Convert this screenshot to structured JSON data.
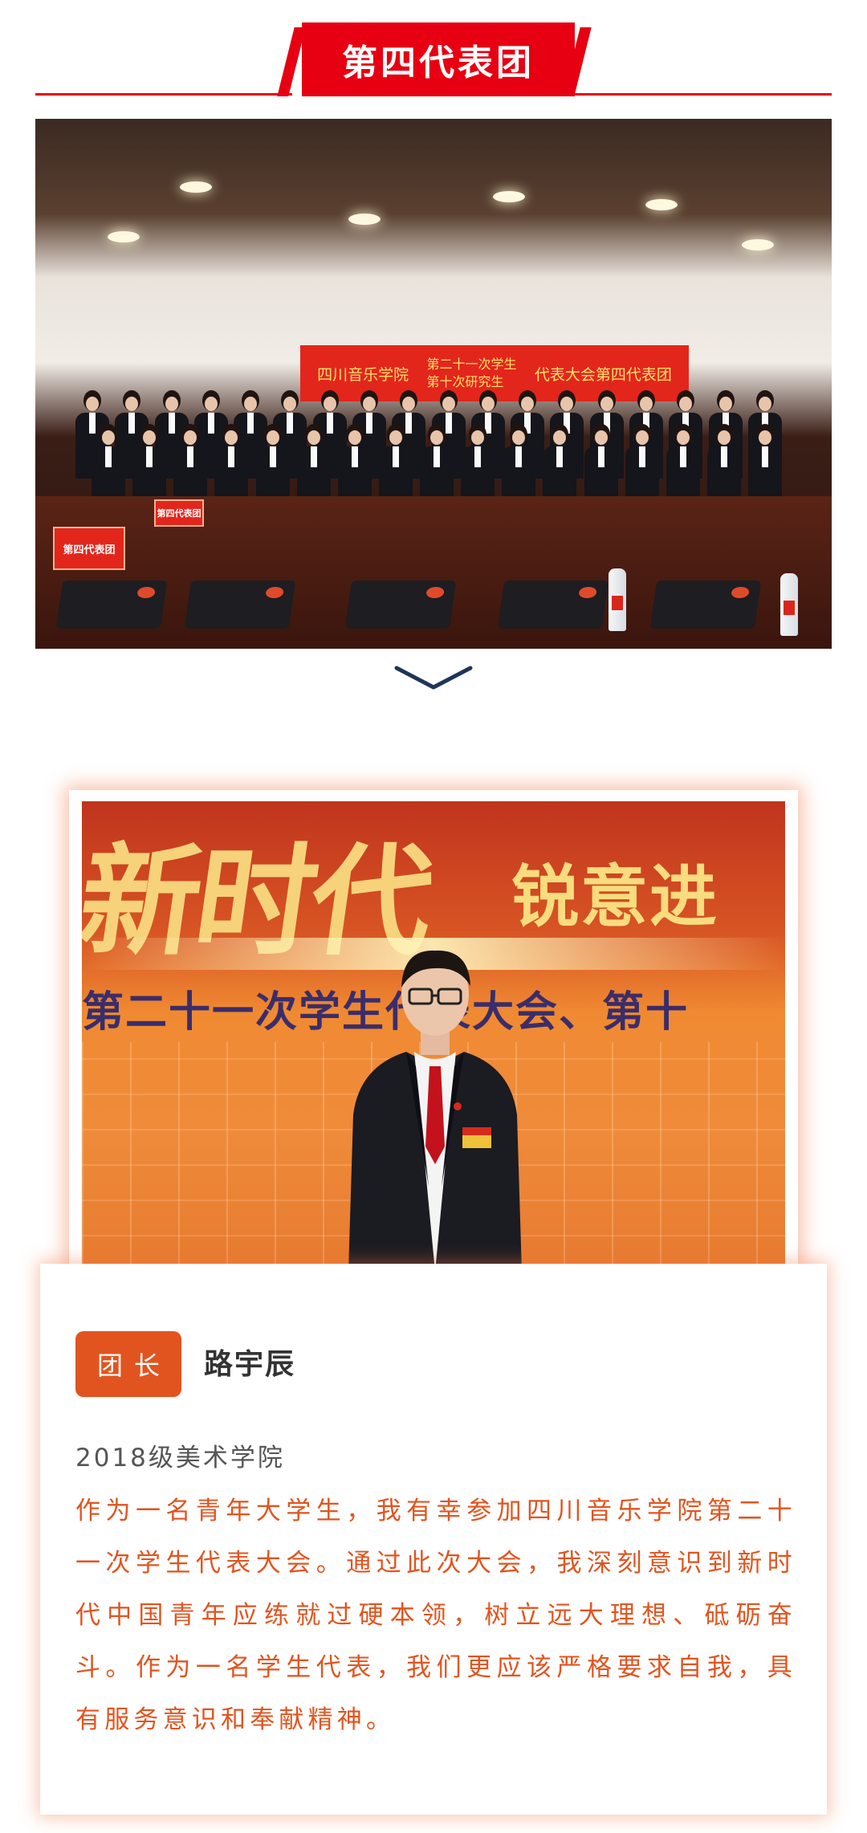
{
  "header": {
    "title": "第四代表团"
  },
  "group_photo": {
    "banner_left": "四川音乐学院",
    "banner_stack_top": "第二十一次学生",
    "banner_stack_bottom": "第十次研究生",
    "banner_right": "代表大会第四代表团",
    "name_card": "第四代表团"
  },
  "portrait": {
    "backdrop_main": "新时代",
    "backdrop_side": "锐意进",
    "backdrop_sub": "第二十一次学生代表大会、第十"
  },
  "profile": {
    "role": "团长",
    "name": "路宇辰",
    "class": "2018级美术学院",
    "statement": "作为一名青年大学生，我有幸参加四川音乐学院第二十一次学生代表大会。通过此次大会，我深刻意识到新时代中国青年应练就过硬本领，树立远大理想、砥砺奋斗。作为一名学生代表，我们更应该严格要求自我，具有服务意识和奉献精神。"
  },
  "colors": {
    "brand_red": "#e60012",
    "accent_orange": "#e2541f"
  }
}
